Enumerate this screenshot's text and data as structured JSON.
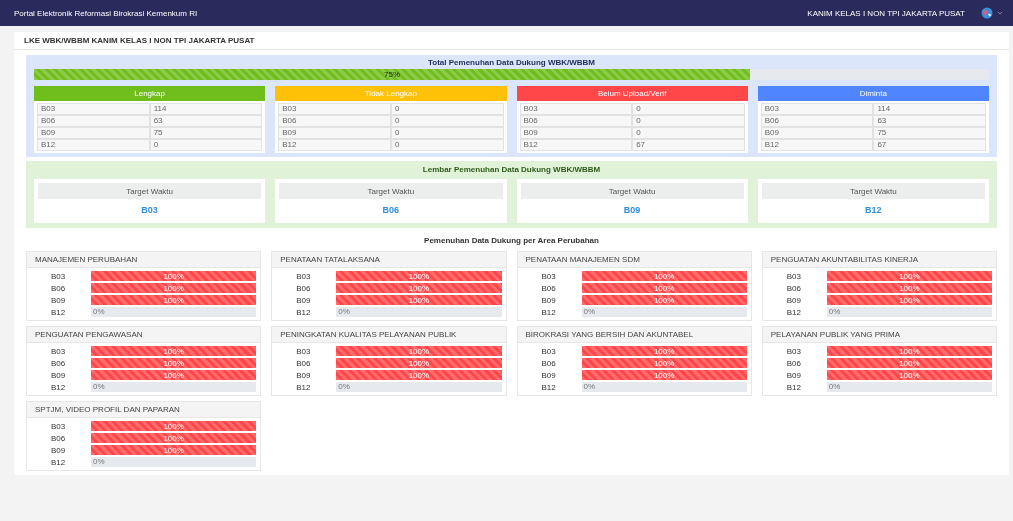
{
  "header": {
    "title": "Portal Elektronik Reformasi Birokrasi Kemenkum RI",
    "user": "KANIM KELAS I NON TPI JAKARTA PUSAT"
  },
  "page_title": "LKE WBK/WBBM KANIM KELAS I NON TPI JAKARTA PUSAT",
  "summary": {
    "title": "Total Pemenuhan Data Dukung WBK/WBBM",
    "progress": {
      "level": 0.75,
      "reading": "75%"
    },
    "categories": [
      {
        "title": "Lengkap",
        "color": "#6fbe1c",
        "rows": [
          {
            "code": "B03",
            "value": "114"
          },
          {
            "code": "B06",
            "value": "63"
          },
          {
            "code": "B09",
            "value": "75"
          },
          {
            "code": "B12",
            "value": "0"
          }
        ]
      },
      {
        "title": "Tidak Lengkap",
        "color": "#ffc107",
        "rows": [
          {
            "code": "B03",
            "value": "0"
          },
          {
            "code": "B06",
            "value": "0"
          },
          {
            "code": "B09",
            "value": "0"
          },
          {
            "code": "B12",
            "value": "0"
          }
        ]
      },
      {
        "title": "Belum Upload/Verif",
        "color": "#ff4648",
        "rows": [
          {
            "code": "B03",
            "value": "0"
          },
          {
            "code": "B06",
            "value": "0"
          },
          {
            "code": "B09",
            "value": "0"
          },
          {
            "code": "B12",
            "value": "67"
          }
        ]
      },
      {
        "title": "Diminta",
        "color": "#4f86ff",
        "rows": [
          {
            "code": "B03",
            "value": "114"
          },
          {
            "code": "B06",
            "value": "63"
          },
          {
            "code": "B09",
            "value": "75"
          },
          {
            "code": "B12",
            "value": "67"
          }
        ]
      }
    ]
  },
  "targets": {
    "title": "Lembar Pemenuhan Data Dukung WBK/WBBM",
    "cards": [
      {
        "label": "Target Waktu",
        "code": "B03"
      },
      {
        "label": "Target Waktu",
        "code": "B06"
      },
      {
        "label": "Target Waktu",
        "code": "B09"
      },
      {
        "label": "Target Waktu",
        "code": "B12"
      }
    ]
  },
  "areas": {
    "title": "Pemenuhan Data Dukung per Area Perubahan",
    "items": [
      {
        "name": "MANAJEMEN PERUBAHAN",
        "rows": [
          {
            "code": "B03",
            "level": 1,
            "reading": "100%"
          },
          {
            "code": "B06",
            "level": 1,
            "reading": "100%"
          },
          {
            "code": "B09",
            "level": 1,
            "reading": "100%"
          },
          {
            "code": "B12",
            "level": 0,
            "reading": "0%"
          }
        ]
      },
      {
        "name": "PENATAAN TATALAKSANA",
        "rows": [
          {
            "code": "B03",
            "level": 1,
            "reading": "100%"
          },
          {
            "code": "B06",
            "level": 1,
            "reading": "100%"
          },
          {
            "code": "B09",
            "level": 1,
            "reading": "100%"
          },
          {
            "code": "B12",
            "level": 0,
            "reading": "0%"
          }
        ]
      },
      {
        "name": "PENATAAN MANAJEMEN SDM",
        "rows": [
          {
            "code": "B03",
            "level": 1,
            "reading": "100%"
          },
          {
            "code": "B06",
            "level": 1,
            "reading": "100%"
          },
          {
            "code": "B09",
            "level": 1,
            "reading": "100%"
          },
          {
            "code": "B12",
            "level": 0,
            "reading": "0%"
          }
        ]
      },
      {
        "name": "PENGUATAN AKUNTABILITAS KINERJA",
        "rows": [
          {
            "code": "B03",
            "level": 1,
            "reading": "100%"
          },
          {
            "code": "B06",
            "level": 1,
            "reading": "100%"
          },
          {
            "code": "B09",
            "level": 1,
            "reading": "100%"
          },
          {
            "code": "B12",
            "level": 0,
            "reading": "0%"
          }
        ]
      },
      {
        "name": "PENGUATAN PENGAWASAN",
        "rows": [
          {
            "code": "B03",
            "level": 1,
            "reading": "100%"
          },
          {
            "code": "B06",
            "level": 1,
            "reading": "100%"
          },
          {
            "code": "B09",
            "level": 1,
            "reading": "100%"
          },
          {
            "code": "B12",
            "level": 0,
            "reading": "0%"
          }
        ]
      },
      {
        "name": "PENINGKATAN KUALITAS PELAYANAN PUBLIK",
        "rows": [
          {
            "code": "B03",
            "level": 1,
            "reading": "100%"
          },
          {
            "code": "B06",
            "level": 1,
            "reading": "100%"
          },
          {
            "code": "B09",
            "level": 1,
            "reading": "100%"
          },
          {
            "code": "B12",
            "level": 0,
            "reading": "0%"
          }
        ]
      },
      {
        "name": "BIROKRASI YANG BERSIH DAN AKUNTABEL",
        "rows": [
          {
            "code": "B03",
            "level": 1,
            "reading": "100%"
          },
          {
            "code": "B06",
            "level": 1,
            "reading": "100%"
          },
          {
            "code": "B09",
            "level": 1,
            "reading": "100%"
          },
          {
            "code": "B12",
            "level": 0,
            "reading": "0%"
          }
        ]
      },
      {
        "name": "PELAYANAN PUBLIK YANG PRIMA",
        "rows": [
          {
            "code": "B03",
            "level": 1,
            "reading": "100%"
          },
          {
            "code": "B06",
            "level": 1,
            "reading": "100%"
          },
          {
            "code": "B09",
            "level": 1,
            "reading": "100%"
          },
          {
            "code": "B12",
            "level": 0,
            "reading": "0%"
          }
        ]
      },
      {
        "name": "SPTJM, VIDEO PROFIL DAN PAPARAN",
        "rows": [
          {
            "code": "B03",
            "level": 1,
            "reading": "100%"
          },
          {
            "code": "B06",
            "level": 1,
            "reading": "100%"
          },
          {
            "code": "B09",
            "level": 1,
            "reading": "100%"
          },
          {
            "code": "B12",
            "level": 0,
            "reading": "0%"
          }
        ]
      }
    ]
  }
}
